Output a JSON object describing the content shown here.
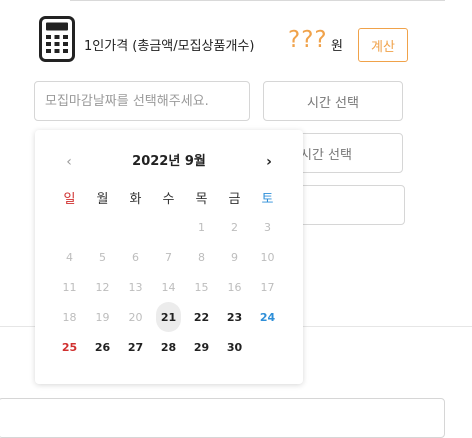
{
  "price": {
    "label": "1인가격 (총금액/모집상품개수)",
    "value": "???",
    "unit": "원",
    "calc_button": "계산",
    "accent_color": "#f0a24a"
  },
  "deadline": {
    "date_placeholder": "모집마감날짜를 선택해주세요.",
    "time_button": "시간 선택",
    "time_button_2": "시간 선택"
  },
  "calendar": {
    "title": "2022년 9월",
    "prev_icon": "chevron-left-icon",
    "next_icon": "chevron-right-icon",
    "weekdays": [
      "일",
      "월",
      "화",
      "수",
      "목",
      "금",
      "토"
    ],
    "weeks": [
      [
        "",
        "",
        "",
        "",
        "1",
        "2",
        "3"
      ],
      [
        "4",
        "5",
        "6",
        "7",
        "8",
        "9",
        "10"
      ],
      [
        "11",
        "12",
        "13",
        "14",
        "15",
        "16",
        "17"
      ],
      [
        "18",
        "19",
        "20",
        "21",
        "22",
        "23",
        "24"
      ],
      [
        "25",
        "26",
        "27",
        "28",
        "29",
        "30",
        ""
      ]
    ],
    "today": "21",
    "first_selectable": 21,
    "sunday_color": "#d0302f",
    "saturday_color": "#2f8fd8"
  }
}
